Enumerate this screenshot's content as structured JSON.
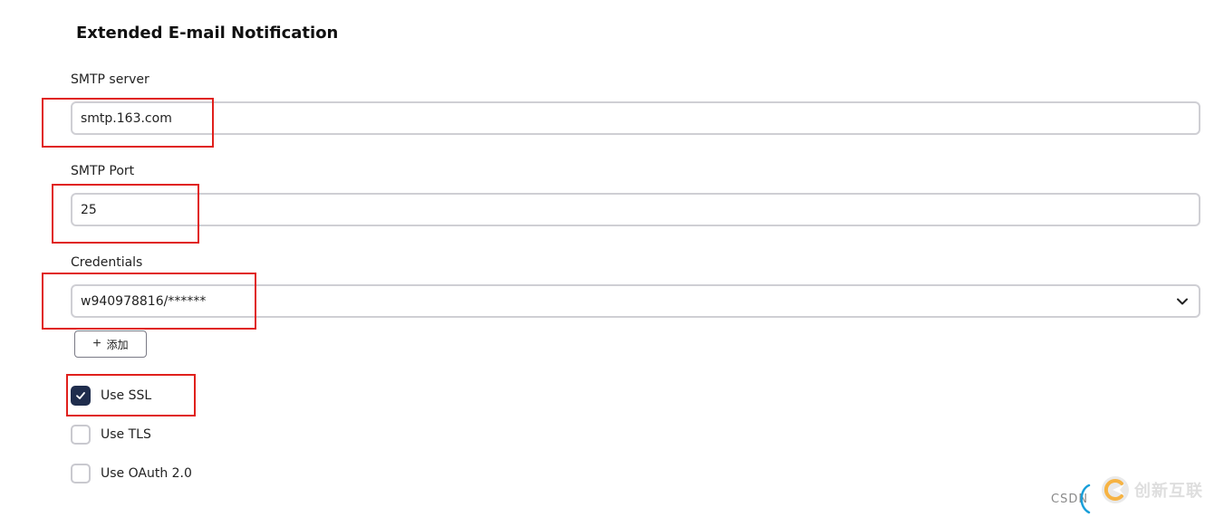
{
  "section": {
    "title": "Extended E-mail Notification"
  },
  "smtp_server": {
    "label": "SMTP server",
    "value": "smtp.163.com"
  },
  "smtp_port": {
    "label": "SMTP Port",
    "value": "25"
  },
  "credentials": {
    "label": "Credentials",
    "selected": "w940978816/******",
    "add_button": {
      "plus": "+",
      "label": "添加"
    }
  },
  "options": [
    {
      "label": "Use SSL",
      "checked": true
    },
    {
      "label": "Use TLS",
      "checked": false
    },
    {
      "label": "Use OAuth 2.0",
      "checked": false
    }
  ],
  "watermark": {
    "csdn": "CSDN",
    "brand": "创新互联"
  },
  "colors": {
    "checkbox_checked": "#1f2d4d",
    "highlight": "#e0201c",
    "input_border": "#cfcfd4"
  },
  "icons": {
    "select_chevron": "chevron-down-icon",
    "checkmark": "checkmark-icon",
    "watermark_logo": "brand-logo-icon"
  }
}
